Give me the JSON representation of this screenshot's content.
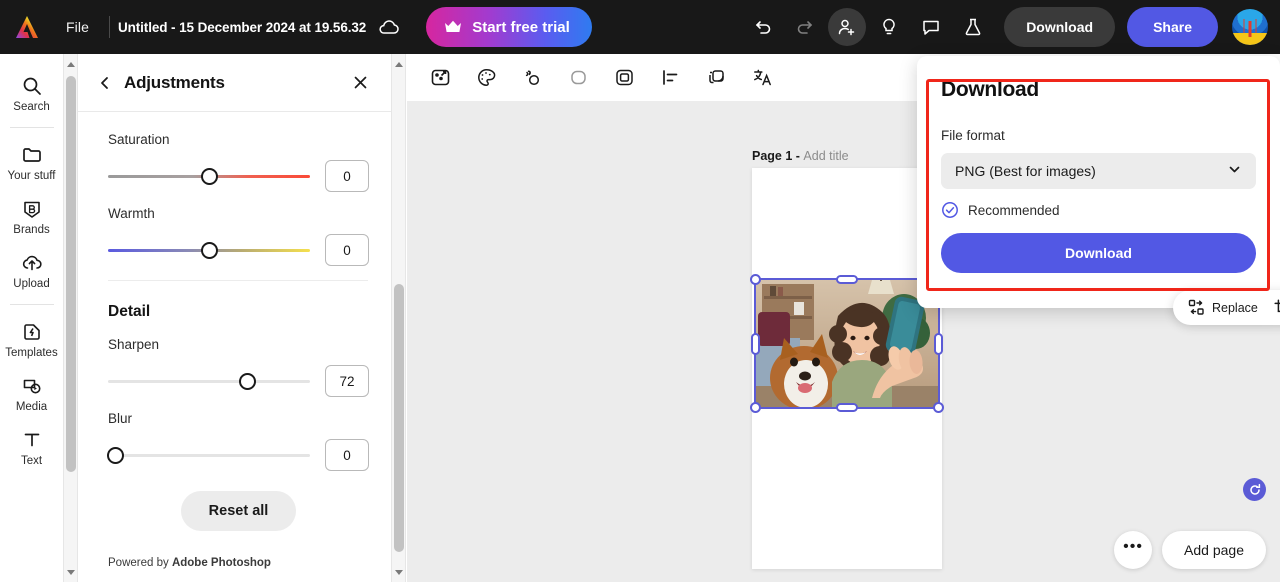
{
  "app": {
    "name": "Adobe Express",
    "logo_icon": "adobe-express-logo"
  },
  "topbar": {
    "file_menu": "File",
    "doc_title": "Untitled - 15 December 2024 at 19.56.32",
    "cloud_icon": "cloud-icon",
    "trial_label": "Start free trial",
    "trial_icon": "crown-icon",
    "icons": [
      {
        "name": "undo-icon",
        "label": "Undo"
      },
      {
        "name": "redo-icon",
        "label": "Redo"
      },
      {
        "name": "invite-user-icon",
        "label": "Invite"
      },
      {
        "name": "lightbulb-icon",
        "label": "Ideas"
      },
      {
        "name": "comment-icon",
        "label": "Comments"
      },
      {
        "name": "flask-icon",
        "label": "Experiments"
      }
    ],
    "download_label": "Download",
    "share_label": "Share",
    "avatar_name": "user-avatar",
    "brand_color": "#5258e4"
  },
  "sidebar": {
    "items": [
      {
        "label": "Search",
        "icon": "search-icon"
      },
      {
        "label": "Your stuff",
        "icon": "folder-icon"
      },
      {
        "label": "Brands",
        "icon": "brand-badge-icon"
      },
      {
        "label": "Upload",
        "icon": "upload-cloud-icon"
      },
      {
        "label": "Templates",
        "icon": "templates-icon"
      },
      {
        "label": "Media",
        "icon": "media-icon"
      },
      {
        "label": "Text",
        "icon": "text-icon"
      }
    ]
  },
  "panel": {
    "title": "Adjustments",
    "back_icon": "chevron-left-icon",
    "close_icon": "close-icon",
    "controls": [
      {
        "label": "Saturation",
        "value": "0",
        "knob_pct": 50,
        "track": "sat"
      },
      {
        "label": "Warmth",
        "value": "0",
        "knob_pct": 50,
        "track": "warm"
      }
    ],
    "section_title": "Detail",
    "detail_controls": [
      {
        "label": "Sharpen",
        "value": "72",
        "knob_pct": 70,
        "track": "plain"
      },
      {
        "label": "Blur",
        "value": "0",
        "knob_pct": 0,
        "track": "plain"
      }
    ],
    "reset_label": "Reset all",
    "powered_prefix": "Powered by ",
    "powered_brand": "Adobe Photoshop"
  },
  "canvas": {
    "toolbar_icons": [
      {
        "name": "enhance-icon"
      },
      {
        "name": "color-palette-icon"
      },
      {
        "name": "cutout-icon"
      },
      {
        "name": "shape-icon"
      },
      {
        "name": "frame-icon"
      },
      {
        "name": "align-icon"
      },
      {
        "name": "layers-icon"
      },
      {
        "name": "translate-icon"
      }
    ],
    "page_label": "Page 1 - ",
    "page_title_placeholder": "Add title",
    "float_toolbar": {
      "replace_label": "Replace",
      "replace_icon": "replace-icon",
      "crop_icon": "crop-icon",
      "delete_icon": "trash-icon",
      "more_icon": "more-dots-icon"
    },
    "rotate_icon": "rotate-icon",
    "selection_color": "#5b5bd6",
    "more_label": "•••",
    "add_page_label": "Add page"
  },
  "download_popup": {
    "title": "Download",
    "file_format_label": "File format",
    "selected_format": "PNG (Best for images)",
    "chevron_icon": "chevron-down-icon",
    "recommended_label": "Recommended",
    "recommended_icon": "check-circle-icon",
    "button_label": "Download",
    "highlight_color": "#f0261a"
  }
}
